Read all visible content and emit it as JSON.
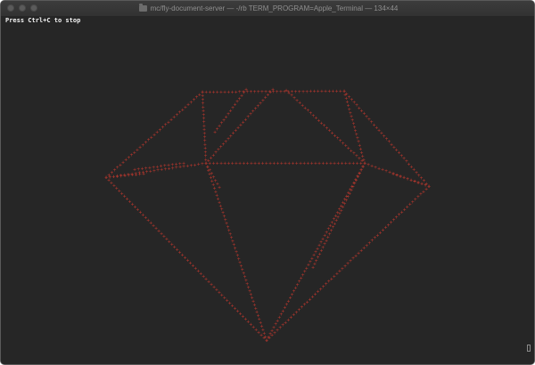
{
  "window": {
    "title": "mc/fly-document-server — -/rb TERM_PROGRAM=Apple_Terminal — 134×44"
  },
  "titlebar": {
    "close_icon": "close-dot",
    "minimize_icon": "minimize-dot",
    "zoom_icon": "zoom-dot",
    "folder_icon": "folder-icon"
  },
  "terminal": {
    "output_line": "Press Ctrl+C to stop",
    "art_glyph": "+",
    "art_color": "#b8372d",
    "background": "#262626",
    "text_color": "#f2f2f2"
  }
}
